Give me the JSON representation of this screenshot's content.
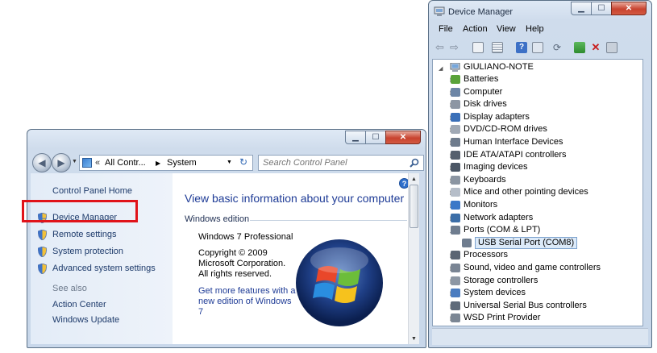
{
  "system_window": {
    "breadcrumb": [
      "All Contr...",
      "System"
    ],
    "search_placeholder": "Search Control Panel",
    "tasks": {
      "home": "Control Panel Home",
      "device_manager": "Device Manager",
      "remote_settings": "Remote settings",
      "system_protection": "System protection",
      "advanced_settings": "Advanced system settings"
    },
    "see_also_header": "See also",
    "see_also": [
      "Action Center",
      "Windows Update"
    ],
    "heading": "View basic information about your computer",
    "edition_section": "Windows edition",
    "edition": "Windows 7 Professional",
    "copyright": [
      "Copyright © 2009",
      "Microsoft Corporation.",
      "All rights reserved."
    ],
    "upgrade_link": [
      "Get more features with a",
      "new edition of Windows",
      "7"
    ]
  },
  "device_manager": {
    "title": "Device Manager",
    "menu": [
      "File",
      "Action",
      "View",
      "Help"
    ],
    "root": "GIULIANO-NOTE",
    "categories": [
      {
        "label": "Batteries",
        "icon": "battery-icon"
      },
      {
        "label": "Computer",
        "icon": "computer-icon"
      },
      {
        "label": "Disk drives",
        "icon": "disk-drive-icon"
      },
      {
        "label": "Display adapters",
        "icon": "display-adapter-icon"
      },
      {
        "label": "DVD/CD-ROM drives",
        "icon": "dvd-drive-icon"
      },
      {
        "label": "Human Interface Devices",
        "icon": "hid-icon"
      },
      {
        "label": "IDE ATA/ATAPI controllers",
        "icon": "ide-controller-icon"
      },
      {
        "label": "Imaging devices",
        "icon": "camera-icon"
      },
      {
        "label": "Keyboards",
        "icon": "keyboard-icon"
      },
      {
        "label": "Mice and other pointing devices",
        "icon": "mouse-icon"
      },
      {
        "label": "Monitors",
        "icon": "monitor-icon"
      },
      {
        "label": "Network adapters",
        "icon": "network-adapter-icon"
      },
      {
        "label": "Ports (COM & LPT)",
        "icon": "port-icon",
        "expanded": true
      },
      {
        "label": "USB Serial Port (COM8)",
        "icon": "port-icon",
        "child": true,
        "selected": true
      },
      {
        "label": "Processors",
        "icon": "processor-icon"
      },
      {
        "label": "Sound, video and game controllers",
        "icon": "sound-icon"
      },
      {
        "label": "Storage controllers",
        "icon": "storage-icon"
      },
      {
        "label": "System devices",
        "icon": "system-device-icon"
      },
      {
        "label": "Universal Serial Bus controllers",
        "icon": "usb-icon"
      },
      {
        "label": "WSD Print Provider",
        "icon": "printer-icon"
      }
    ]
  }
}
